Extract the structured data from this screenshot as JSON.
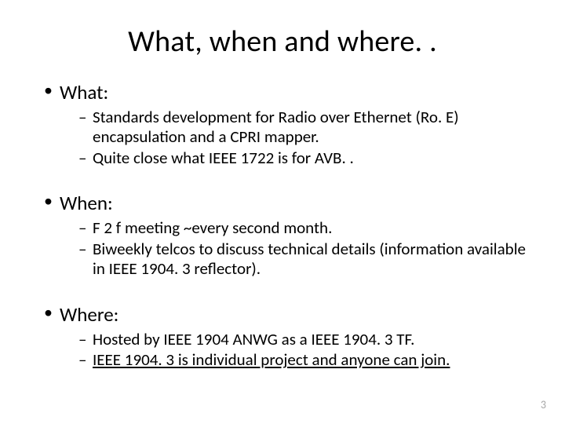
{
  "title": "What, when and where. .",
  "sections": [
    {
      "label": "What:",
      "items": [
        "Standards development for Radio over Ethernet (Ro. E) encapsulation and a CPRI mapper.",
        "Quite close what IEEE 1722 is for AVB. ."
      ]
    },
    {
      "label": "When:",
      "items": [
        "F 2 f meeting ~every second month.",
        "Biweekly telcos to discuss technical details (information available in IEEE 1904. 3 reflector)."
      ]
    },
    {
      "label": "Where:",
      "items": [
        "Hosted by IEEE 1904 ANWG as a IEEE 1904. 3 TF.",
        "IEEE 1904. 3 is individual project and anyone can join."
      ],
      "underline_last": true
    }
  ],
  "page_number": "3"
}
